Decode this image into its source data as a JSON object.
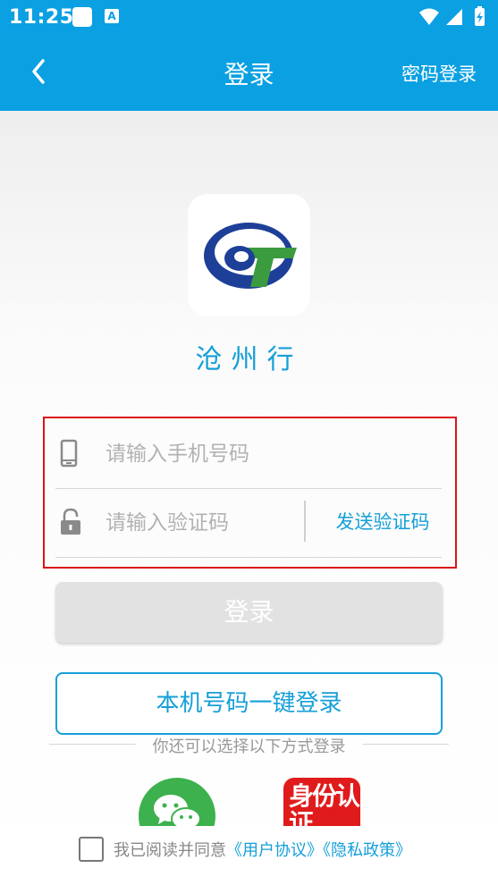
{
  "status_bar": {
    "time": "11:25",
    "notification_letter": "A"
  },
  "app_bar": {
    "title": "登录",
    "right_action": "密码登录"
  },
  "app": {
    "name": "沧州行"
  },
  "form": {
    "phone_placeholder": "请输入手机号码",
    "code_placeholder": "请输入验证码",
    "send_code_label": "发送验证码"
  },
  "login_button": "登录",
  "one_key_login_button": "本机号码一键登录",
  "other_methods_text": "你还可以选择以下方式登录",
  "other_methods": [
    {
      "name": "WeChat",
      "icon": "wechat-icon",
      "color": "#3db14e"
    },
    {
      "name": "身份认证",
      "label": "身份认证",
      "icon": "id-auth-icon",
      "color": "#e01b1b"
    }
  ],
  "agreement": {
    "prefix": "我已阅读并同意",
    "user_agreement": "《用户协议》",
    "privacy_policy": "《隐私政策》"
  },
  "colors": {
    "primary": "#0aa0e2",
    "accent": "#159fd8",
    "highlight": "#d9141b"
  }
}
